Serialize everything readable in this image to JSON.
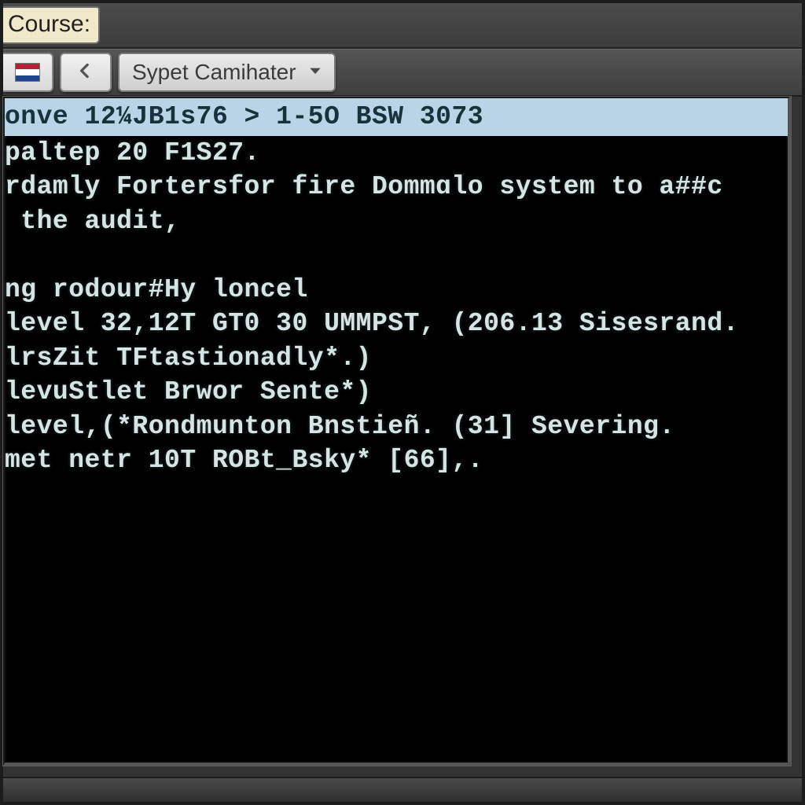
{
  "topbar": {
    "course_label": "Course:"
  },
  "toolbar": {
    "flag_icon": "netherlands-flag-icon",
    "back_icon": "back-arrow-icon",
    "dropdown": {
      "label": "Sypet Camihater",
      "chevron_icon": "chevron-down-icon"
    }
  },
  "terminal": {
    "lines": [
      "onve 12¼JB1s76 > 1-5O BSW 3073",
      "paltep 20 F1S27.",
      "rdamly Fortersfor fire Dommɑlo system to a##c",
      " the audit,",
      "",
      "ng rodour#Hy loncel",
      "level 32,12T GT0 30 UMMPST, (206.13 Sisesrand.",
      "lrsZit TFtastionadly*.)",
      "levuStlet Brwor Sente*)",
      "level,(*Rondmunton Bnstieñ. (31] Severing.",
      "met netr 10T ROBt_Bsky* [66],."
    ],
    "highlight_index": 0
  },
  "colors": {
    "terminal_bg": "#000000",
    "terminal_fg": "#d7e4e4",
    "highlight_bg": "#b8d4e6",
    "highlight_fg": "#18323b",
    "chrome_bg": "#3a3a3a"
  }
}
